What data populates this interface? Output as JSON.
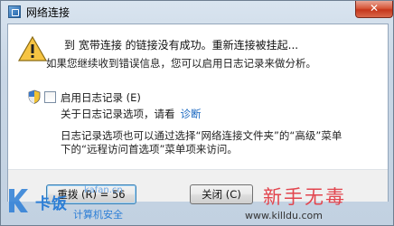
{
  "window": {
    "title": "网络连接",
    "close_label": "✕"
  },
  "message": {
    "main": "到  宽带连接 的链接没有成功。重新连接被挂起...",
    "sub": "如果您继续收到错误信息，您可以启用日志记录来做分析。"
  },
  "logging": {
    "checkbox_label": "启用日志记录 (E)",
    "about_text": "关于日志记录选项，请看",
    "diagnose_link": "诊断",
    "info_line1": "日志记录选项也可以通过选择“网络连接文件夹”的“高级”菜单",
    "info_line2": "下的“远程访问首选项”菜单项来访问。"
  },
  "buttons": {
    "redial": "重拨 (R) = 56",
    "close": "关闭 (C)"
  },
  "watermarks": {
    "brand": "卡饭",
    "url1": "kafan.cn",
    "sub": "计算机安全",
    "big": "新手无毒",
    "url2": "www.killdu.com"
  },
  "colors": {
    "link": "#1565c0",
    "close_button": "#c5371c",
    "watermark_blue": "#2c7ed6",
    "watermark_red": "#e2454e"
  }
}
